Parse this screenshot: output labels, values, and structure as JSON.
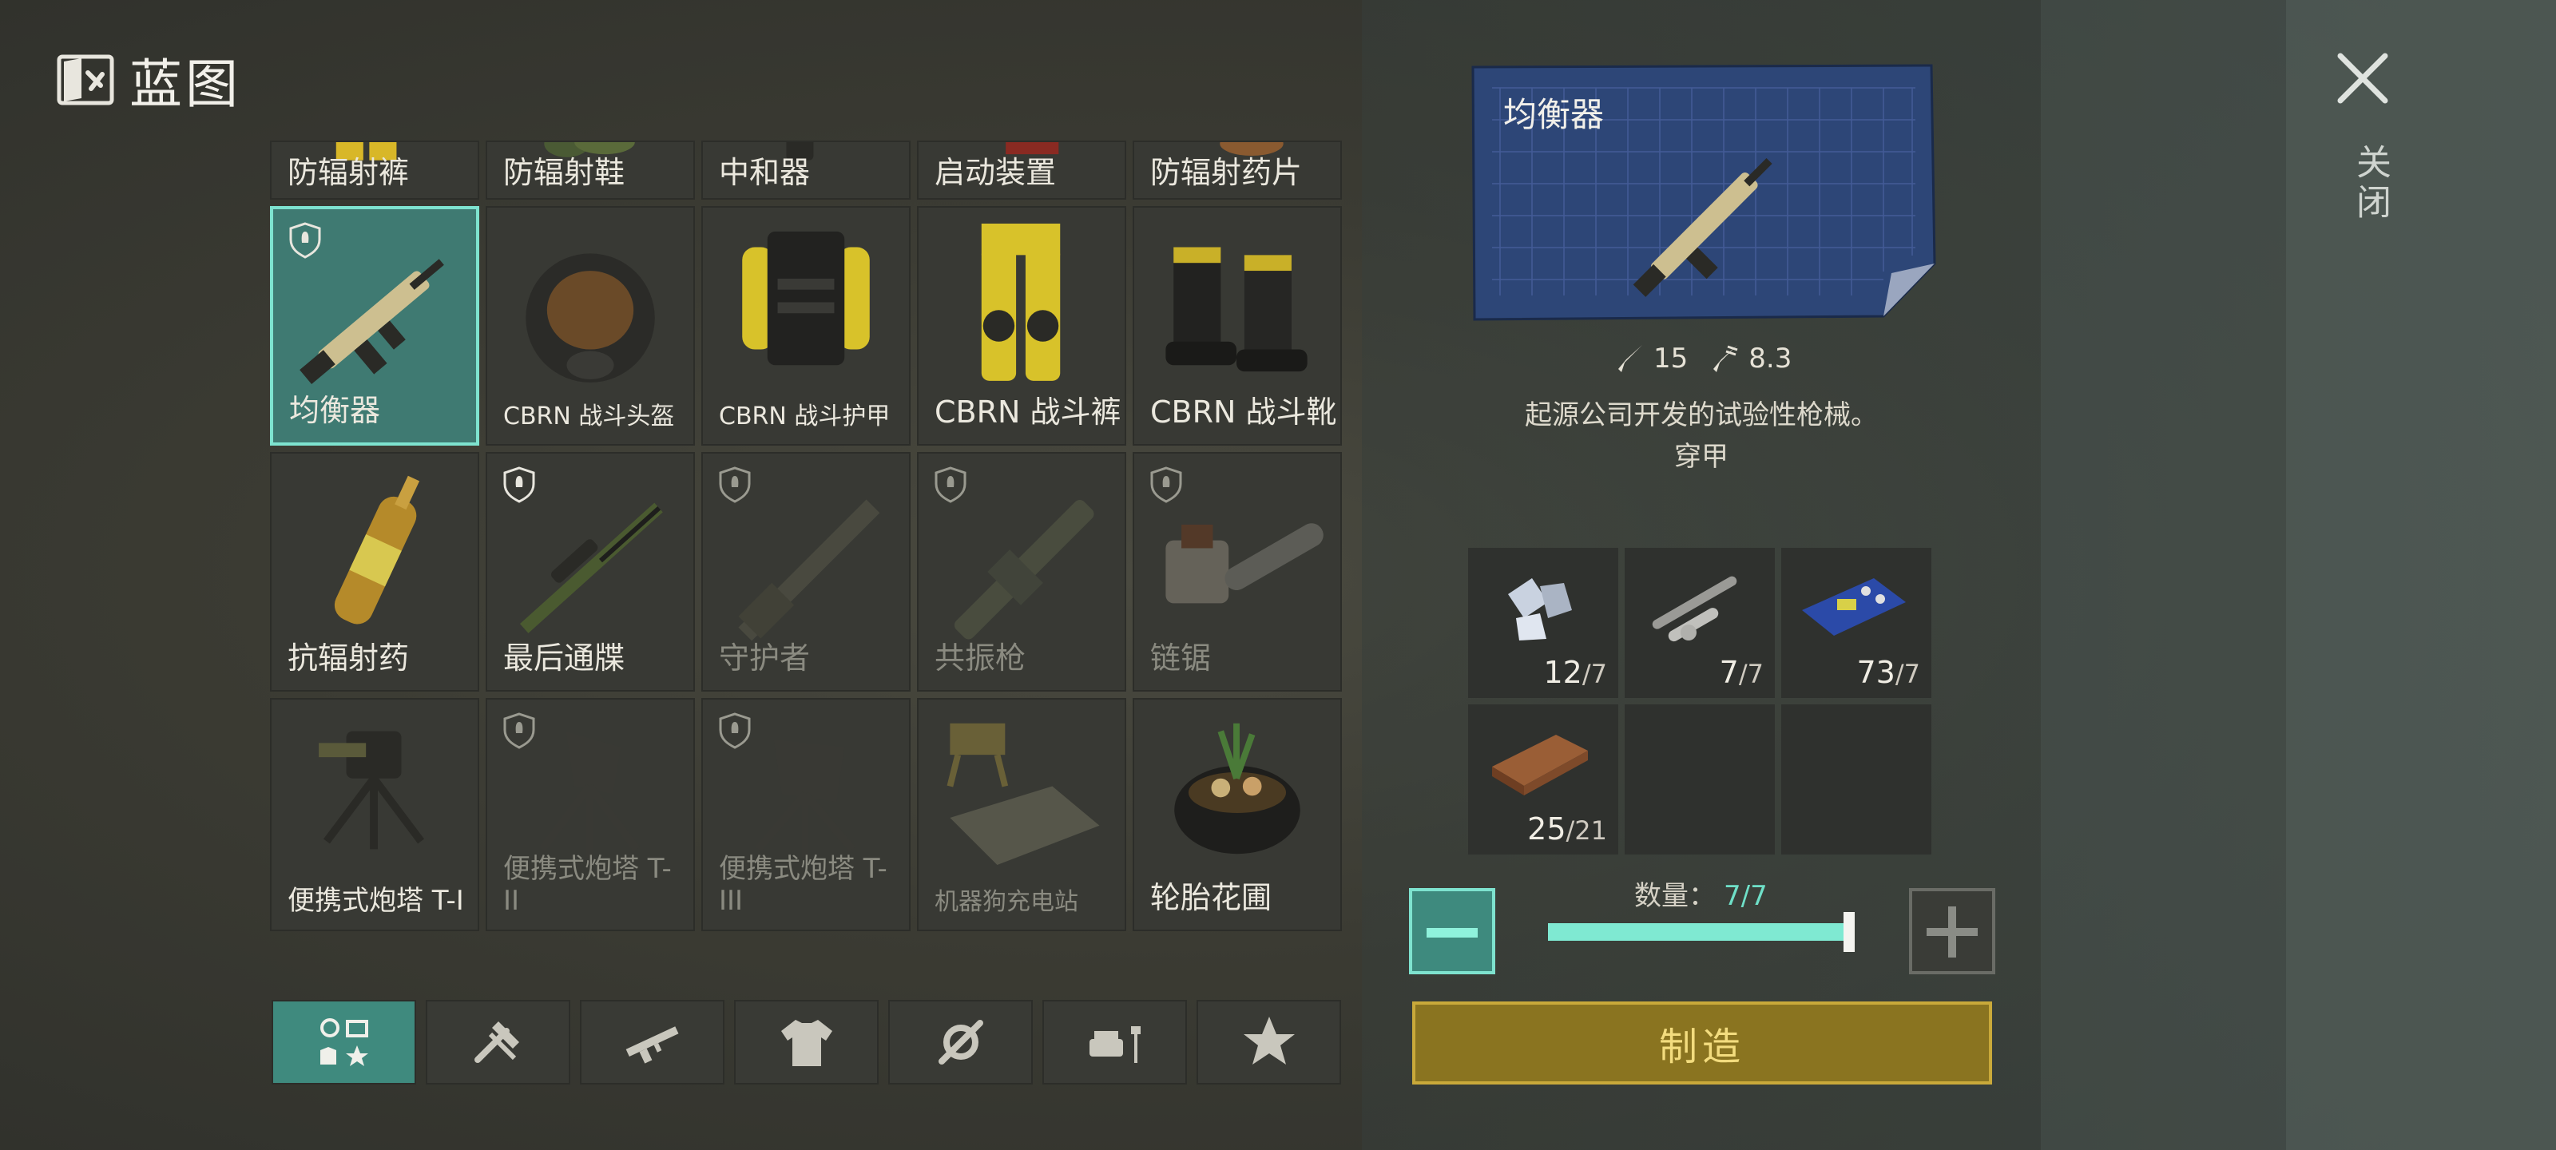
{
  "header": {
    "title": "蓝图",
    "icon": "blueprint-book-icon"
  },
  "close": {
    "label": "关闭",
    "icon": "close-x-icon"
  },
  "grid": {
    "top_row": [
      {
        "name": "防辐射裤",
        "icon": "rad-pants-icon"
      },
      {
        "name": "防辐射鞋",
        "icon": "rad-boots-icon"
      },
      {
        "name": "中和器",
        "icon": "neutralizer-icon"
      },
      {
        "name": "启动装置",
        "icon": "starter-icon"
      },
      {
        "name": "防辐射药片",
        "icon": "rad-pills-icon"
      }
    ],
    "row2": [
      {
        "name": "均衡器",
        "icon": "rifle-icon",
        "selected": true,
        "locked": true
      },
      {
        "name": "CBRN 战斗头盔",
        "icon": "gas-mask-helmet-icon"
      },
      {
        "name": "CBRN 战斗护甲",
        "icon": "yellow-vest-icon"
      },
      {
        "name": "CBRN 战斗裤",
        "icon": "yellow-pants-icon"
      },
      {
        "name": "CBRN 战斗靴",
        "icon": "black-boots-icon"
      }
    ],
    "row3": [
      {
        "name": "抗辐射药",
        "icon": "ampoule-icon"
      },
      {
        "name": "最后通牒",
        "icon": "sniper-rifle-icon",
        "locked": true
      },
      {
        "name": "守护者",
        "icon": "shotgun-icon",
        "locked": true,
        "dim": true
      },
      {
        "name": "共振枪",
        "icon": "resonance-gun-icon",
        "locked": true,
        "dim": true
      },
      {
        "name": "链锯",
        "icon": "chainsaw-icon",
        "locked": true,
        "dim": true
      }
    ],
    "row4": [
      {
        "name": "便携式炮塔 T-I",
        "icon": "turret-icon"
      },
      {
        "name": "便携式炮塔 T-II",
        "icon": "turret-icon",
        "locked": true,
        "dim": true
      },
      {
        "name": "便携式炮塔 T-III",
        "icon": "turret-icon",
        "locked": true,
        "dim": true
      },
      {
        "name": "机器狗充电站",
        "icon": "robodog-station-icon",
        "dim": true
      },
      {
        "name": "轮胎花圃",
        "icon": "tire-planter-icon"
      }
    ]
  },
  "tabs": [
    {
      "icon": "all-categories-icon",
      "active": true
    },
    {
      "icon": "tools-icon"
    },
    {
      "icon": "weapons-icon"
    },
    {
      "icon": "clothing-icon"
    },
    {
      "icon": "mechanics-icon"
    },
    {
      "icon": "furniture-icon"
    },
    {
      "icon": "favorites-star-icon"
    }
  ],
  "detail": {
    "title": "均衡器",
    "stats": [
      {
        "icon": "damage-icon",
        "value": "15"
      },
      {
        "icon": "fire-rate-icon",
        "value": "8.3"
      }
    ],
    "description_line1": "起源公司开发的试验性枪械。",
    "description_line2": "穿甲",
    "materials": [
      {
        "icon": "scrap-metal-icon",
        "have": "12",
        "need": "/7"
      },
      {
        "icon": "weapon-parts-icon",
        "have": "7",
        "need": "/7"
      },
      {
        "icon": "circuit-board-icon",
        "have": "73",
        "need": "/7"
      },
      {
        "icon": "wood-plank-icon",
        "have": "25",
        "need": "/21"
      }
    ],
    "quantity_label": "数量：",
    "quantity_value": "7/7",
    "slider_fraction": 1.0,
    "craft_label": "制造"
  },
  "colors": {
    "accent": "#7ee3cf",
    "selected_bg": "#3f7a72",
    "craft": "#8a7420"
  }
}
